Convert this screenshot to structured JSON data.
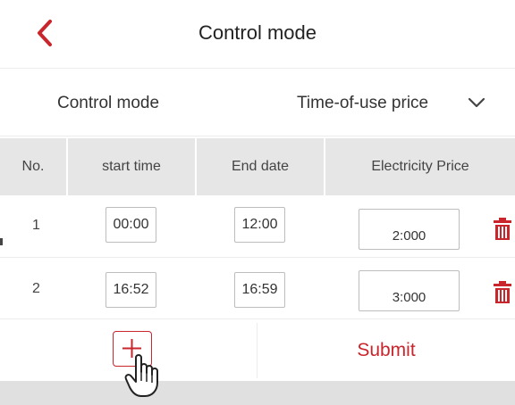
{
  "header": {
    "title": "Control mode",
    "back_icon": "chevron-left-icon"
  },
  "mode": {
    "label": "Control mode",
    "value": "Time-of-use price",
    "dropdown_icon": "chevron-down-icon"
  },
  "table": {
    "columns": [
      "No.",
      "start time",
      "End date",
      "Electricity Price"
    ],
    "rows": [
      {
        "no": "1",
        "start": "00:00",
        "end": "12:00",
        "price": "2:000"
      },
      {
        "no": "2",
        "start": "16:52",
        "end": "16:59",
        "price": "3:000"
      }
    ]
  },
  "actions": {
    "add_icon": "plus-icon",
    "submit_label": "Submit"
  },
  "colors": {
    "accent": "#c9252c",
    "header_bg": "#e6e6e6",
    "footer_bg": "#e0e0e0"
  }
}
